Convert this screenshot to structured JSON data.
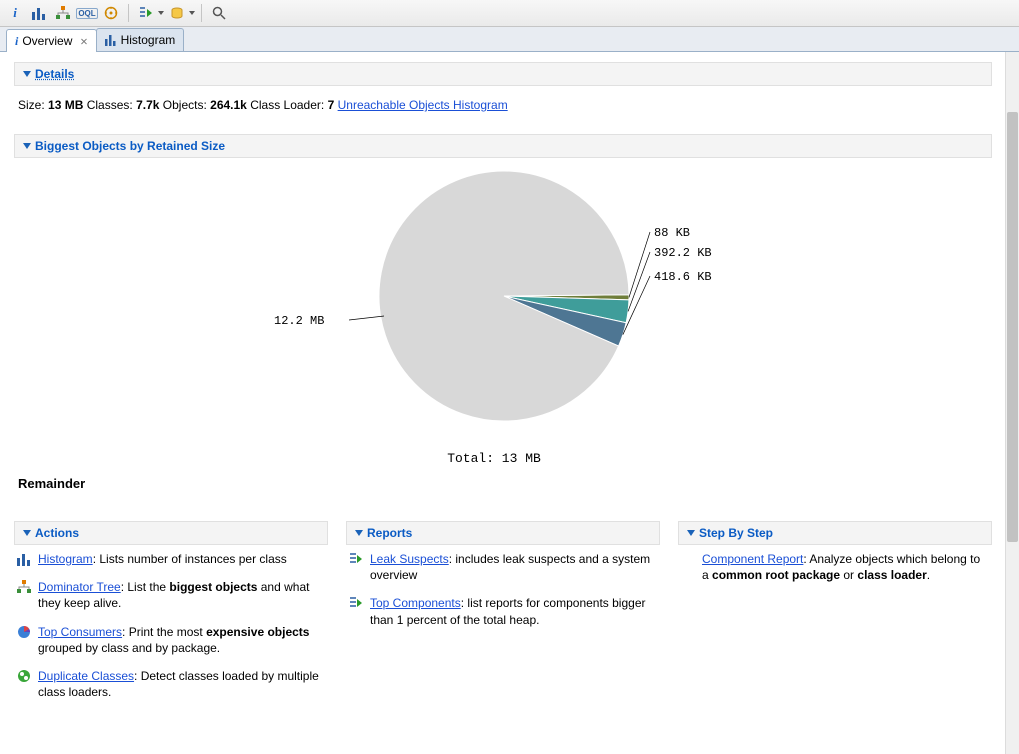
{
  "toolbar": {
    "info_icon": "i",
    "histogram_icon": "hist",
    "tree_icon": "tree",
    "oql_icon": "OQL",
    "gear_icon": "gear",
    "play_icon": "play",
    "db_icon": "db",
    "search_icon": "search"
  },
  "tabs": [
    {
      "label": "Overview",
      "active": true,
      "closable": true
    },
    {
      "label": "Histogram",
      "active": false,
      "closable": false
    }
  ],
  "sections": {
    "details_title": "Details",
    "biggest_title": "Biggest Objects by Retained Size",
    "actions_title": "Actions",
    "reports_title": "Reports",
    "step_title": "Step By Step"
  },
  "details": {
    "size_label": "Size:",
    "size_value": "13 MB",
    "classes_label": "Classes:",
    "classes_value": "7.7k",
    "objects_label": "Objects:",
    "objects_value": "264.1k",
    "loader_label": "Class Loader:",
    "loader_value": "7",
    "unreachable_link": "Unreachable Objects Histogram"
  },
  "chart_data": {
    "type": "pie",
    "title": "",
    "total_label": "Total: 13 MB",
    "total_bytes_approx": 13631488,
    "slices": [
      {
        "label": "12.2 MB",
        "bytes_approx": 12792627,
        "color": "#d8d8d8"
      },
      {
        "label": "418.6 KB",
        "bytes_approx": 428646,
        "color": "#4e7693"
      },
      {
        "label": "392.2 KB",
        "bytes_approx": 401613,
        "color": "#3f9d9a"
      },
      {
        "label": "88 KB",
        "bytes_approx": 90112,
        "color": "#6f7e3a"
      }
    ],
    "remainder_label": "Remainder"
  },
  "actions": [
    {
      "link": "Histogram",
      "rest": ": Lists number of instances per class",
      "icon": "bars"
    },
    {
      "link": "Dominator Tree",
      "rest_pre": ": List the ",
      "bold1": "biggest objects",
      "rest_post": " and what they keep alive.",
      "icon": "tree"
    },
    {
      "link": "Top Consumers",
      "rest_pre": ": Print the most ",
      "bold1": "expensive objects",
      "rest_post": " grouped by class and by package.",
      "icon": "pie"
    },
    {
      "link": "Duplicate Classes",
      "rest": ": Detect classes loaded by multiple class loaders.",
      "icon": "dup"
    }
  ],
  "reports": [
    {
      "link": "Leak Suspects",
      "rest": ": includes leak suspects and a system overview",
      "icon": "report"
    },
    {
      "link": "Top Components",
      "rest": ": list reports for components bigger than 1 percent of the total heap.",
      "icon": "report"
    }
  ],
  "step_by_step": [
    {
      "link": "Component Report",
      "rest_pre": ": Analyze objects which belong to a ",
      "bold1": "common root package",
      "mid": " or ",
      "bold2": "class loader",
      "tail": "."
    }
  ]
}
